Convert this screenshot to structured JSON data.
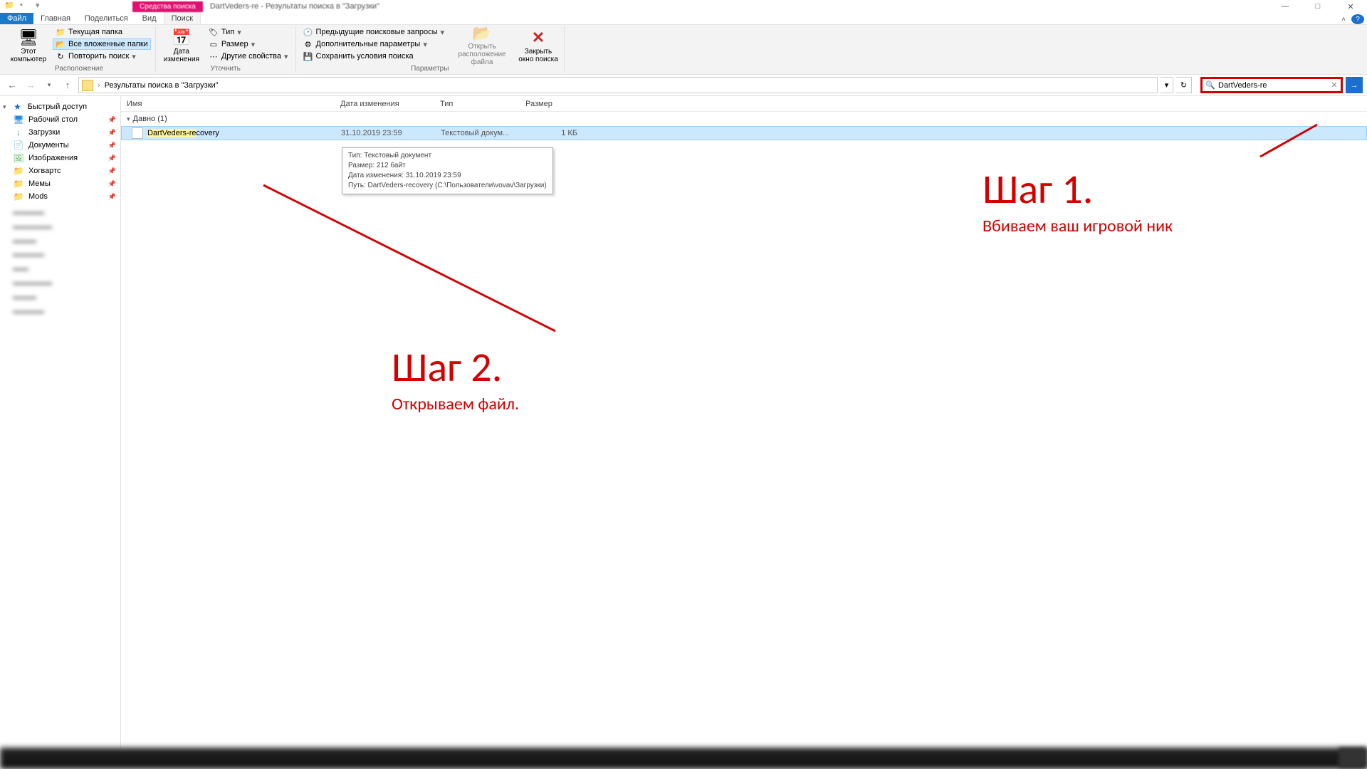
{
  "titlebar": {
    "context_tab": "Средства поиска",
    "title": "DartVeders-re - Результаты поиска в \"Загрузки\""
  },
  "tabs": {
    "file": "Файл",
    "home": "Главная",
    "share": "Поделиться",
    "view": "Вид",
    "search": "Поиск"
  },
  "ribbon": {
    "this_pc": "Этот\nкомпьютер",
    "current_folder": "Текущая папка",
    "all_subfolders": "Все вложенные папки",
    "search_again": "Повторить поиск",
    "group_location": "Расположение",
    "date_modified": "Дата\nизменения",
    "type": "Тип",
    "size": "Размер",
    "other_props": "Другие свойства",
    "group_refine": "Уточнить",
    "prev_searches": "Предыдущие поисковые запросы",
    "advanced": "Дополнительные параметры",
    "save_search": "Сохранить условия поиска",
    "open_location": "Открыть\nрасположение файла",
    "close_search": "Закрыть\nокно поиска",
    "group_options": "Параметры"
  },
  "address": {
    "path": "Результаты поиска в \"Загрузки\""
  },
  "search": {
    "value": "DartVeders-re"
  },
  "sidebar": {
    "quick_access": "Быстрый доступ",
    "items": [
      {
        "label": "Рабочий стол",
        "icon": "🖥",
        "color": "#1e88e5"
      },
      {
        "label": "Загрузки",
        "icon": "↓",
        "color": "#1e88e5"
      },
      {
        "label": "Документы",
        "icon": "📄",
        "color": "#607d8b"
      },
      {
        "label": "Изображения",
        "icon": "🖼",
        "color": "#4caf50"
      },
      {
        "label": "Хогвартс",
        "icon": "📁",
        "color": "#ffc107"
      },
      {
        "label": "Мемы",
        "icon": "📁",
        "color": "#ffc107"
      },
      {
        "label": "Mods",
        "icon": "📁",
        "color": "#ffc107"
      }
    ]
  },
  "columns": {
    "name": "Имя",
    "date": "Дата изменения",
    "type": "Тип",
    "size": "Размер"
  },
  "group_header": "Давно (1)",
  "file": {
    "name_hl": "DartVeders-re",
    "name_rest": "covery",
    "date": "31.10.2019 23:59",
    "type": "Текстовый докум...",
    "size": "1 КБ"
  },
  "tooltip": {
    "l1": "Тип: Текстовый документ",
    "l2": "Размер: 212 байт",
    "l3": "Дата изменения: 31.10.2019 23:59",
    "l4": "Путь: DartVeders-recovery (C:\\Пользователи\\vovav\\Загрузки)"
  },
  "anno1": {
    "title": "Шаг 1.",
    "text": "Вбиваем ваш игровой ник"
  },
  "anno2": {
    "title": "Шаг 2.",
    "text": "Открываем файл."
  }
}
